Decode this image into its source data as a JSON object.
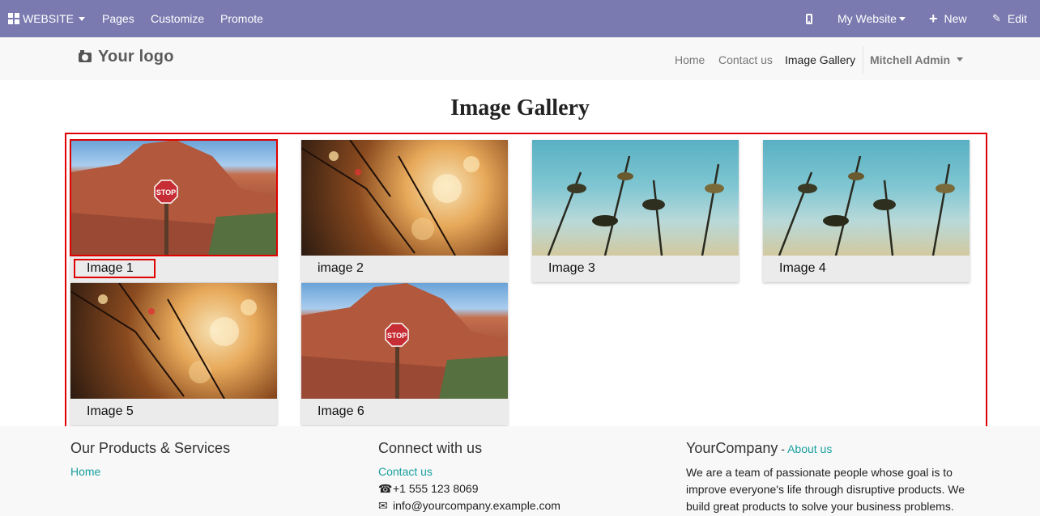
{
  "topbar": {
    "website_label": "WEBSITE",
    "pages": "Pages",
    "customize": "Customize",
    "promote": "Promote",
    "my_website": "My Website",
    "new": "New",
    "edit": "Edit"
  },
  "header": {
    "logo": "Your logo",
    "nav": [
      "Home",
      "Contact us",
      "Image Gallery"
    ],
    "user": "Mitchell Admin"
  },
  "page": {
    "title": "Image Gallery"
  },
  "gallery": {
    "items": [
      {
        "caption": "Image 1",
        "image": "canyon-stop-sign"
      },
      {
        "caption": "image 2",
        "image": "bokeh-branches"
      },
      {
        "caption": "Image 3",
        "image": "leaves-sky"
      },
      {
        "caption": "Image 4",
        "image": "leaves-sky"
      },
      {
        "caption": "Image 5",
        "image": "bokeh-branches"
      },
      {
        "caption": "Image 6",
        "image": "canyon-stop-sign"
      }
    ]
  },
  "footer": {
    "products_title": "Our Products & Services",
    "home_link": "Home",
    "connect_title": "Connect with us",
    "contact_link": "Contact us",
    "phone": "+1 555 123 8069",
    "email": "info@yourcompany.example.com",
    "company_name": "YourCompany",
    "company_sep": " - ",
    "about_link": "About us",
    "about_text": "We are a team of passionate people whose goal is to improve everyone's life through disruptive products. We build great products to solve your business problems."
  },
  "colors": {
    "topbar_bg": "#7a7ab0",
    "accent_link": "#1a9f9f",
    "highlight": "#e00000"
  }
}
